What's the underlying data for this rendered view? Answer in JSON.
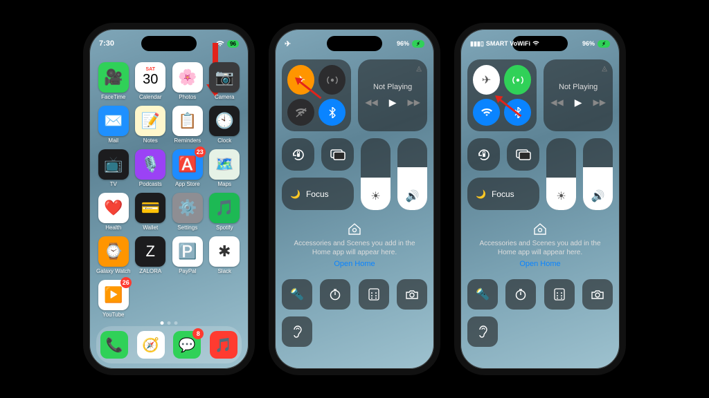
{
  "phone1": {
    "time": "7:30",
    "battery": "96",
    "calendar_day": "SAT",
    "calendar_date": "30",
    "apps": [
      {
        "name": "facetime",
        "label": "FaceTime",
        "bg": "#30d158",
        "emoji": "🎥"
      },
      {
        "name": "calendar",
        "label": "Calendar",
        "bg": "#ffffff",
        "emoji": ""
      },
      {
        "name": "photos",
        "label": "Photos",
        "bg": "#ffffff",
        "emoji": "🌸"
      },
      {
        "name": "camera",
        "label": "Camera",
        "bg": "#3a3a3c",
        "emoji": "📷"
      },
      {
        "name": "mail",
        "label": "Mail",
        "bg": "#1e90ff",
        "emoji": "✉️"
      },
      {
        "name": "notes",
        "label": "Notes",
        "bg": "#fff7cc",
        "emoji": "📝"
      },
      {
        "name": "reminders",
        "label": "Reminders",
        "bg": "#ffffff",
        "emoji": "📋"
      },
      {
        "name": "clock",
        "label": "Clock",
        "bg": "#1c1c1e",
        "emoji": "🕙"
      },
      {
        "name": "tv",
        "label": "TV",
        "bg": "#1c1c1e",
        "emoji": "📺"
      },
      {
        "name": "podcasts",
        "label": "Podcasts",
        "bg": "#9b42f5",
        "emoji": "🎙️"
      },
      {
        "name": "appstore",
        "label": "App Store",
        "bg": "#1f8cff",
        "emoji": "🅰️",
        "badge": "23"
      },
      {
        "name": "maps",
        "label": "Maps",
        "bg": "#e6f2e6",
        "emoji": "🗺️"
      },
      {
        "name": "health",
        "label": "Health",
        "bg": "#ffffff",
        "emoji": "❤️"
      },
      {
        "name": "wallet",
        "label": "Wallet",
        "bg": "#1c1c1e",
        "emoji": "💳"
      },
      {
        "name": "settings",
        "label": "Settings",
        "bg": "#8e8e93",
        "emoji": "⚙️"
      },
      {
        "name": "spotify",
        "label": "Spotify",
        "bg": "#1db954",
        "emoji": "🎵"
      },
      {
        "name": "galaxywatch",
        "label": "Galaxy Watch",
        "bg": "#ff9500",
        "emoji": "⌚"
      },
      {
        "name": "zalora",
        "label": "ZALORA",
        "bg": "#1c1c1e",
        "emoji": "Z"
      },
      {
        "name": "paypal",
        "label": "PayPal",
        "bg": "#ffffff",
        "emoji": "🅿️"
      },
      {
        "name": "slack",
        "label": "Slack",
        "bg": "#ffffff",
        "emoji": "✱"
      },
      {
        "name": "youtube",
        "label": "YouTube",
        "bg": "#ffffff",
        "emoji": "▶️",
        "badge": "26"
      }
    ],
    "dock": [
      {
        "name": "phone",
        "bg": "#30d158",
        "emoji": "📞"
      },
      {
        "name": "safari",
        "bg": "#ffffff",
        "emoji": "🧭"
      },
      {
        "name": "messages",
        "bg": "#30d158",
        "emoji": "💬",
        "badge": "8"
      },
      {
        "name": "music",
        "bg": "#ff3b30",
        "emoji": "🎵"
      }
    ]
  },
  "phone2": {
    "battery": "96%",
    "connectivity": {
      "airplane": "on",
      "cellular": "off",
      "wifi": "off",
      "bluetooth": "on"
    }
  },
  "phone3": {
    "carrier": "SMART VoWiFi",
    "battery": "96%",
    "connectivity": {
      "airplane": "on",
      "cellular": "on",
      "wifi": "on",
      "bluetooth": "on"
    }
  },
  "cc": {
    "not_playing": "Not Playing",
    "focus": "Focus",
    "brightness_pct": 45,
    "volume_pct": 60,
    "home_title_icon": "home",
    "home_msg": "Accessories and Scenes you add in the Home app will appear here.",
    "home_link": "Open Home"
  }
}
